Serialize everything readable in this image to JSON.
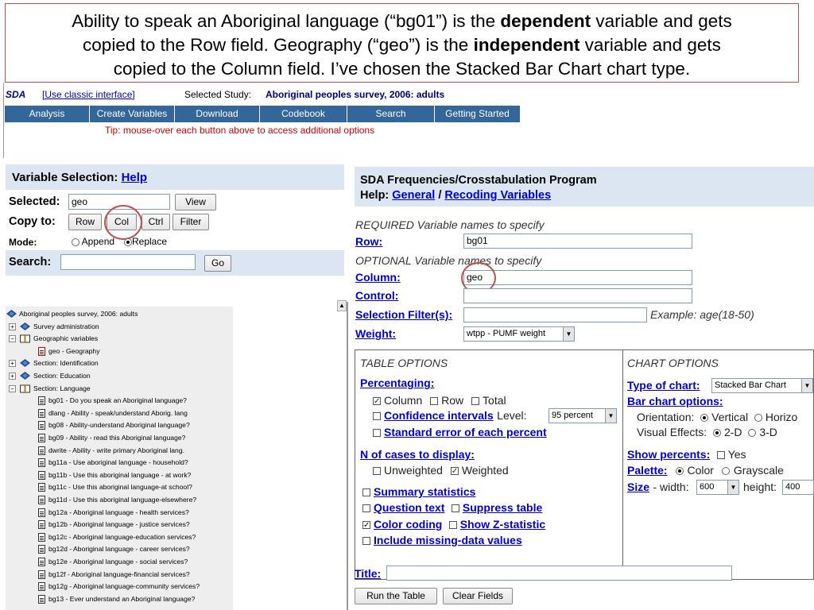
{
  "caption": {
    "line1_a": "Ability to speak an Aboriginal language (“bg01”) is the ",
    "line1_b": "dependent",
    "line1_c": " variable and gets",
    "line2_a": "copied to the Row field.  Geography (“geo”) is the ",
    "line2_b": "independent",
    "line2_c": " variable and gets",
    "line3": "copied to the Column field.  I’ve chosen the Stacked Bar Chart chart type."
  },
  "topbar": {
    "logo": "SDA",
    "classic_link": "[Use classic interface]",
    "study_label": "Selected Study:",
    "study_name": "Aboriginal peoples survey, 2006: adults"
  },
  "nav": [
    "Analysis",
    "Create Variables",
    "Download",
    "Codebook",
    "Search",
    "Getting Started"
  ],
  "tip": "Tip: mouse-over each button above to access additional options",
  "left": {
    "heading": "Variable Selection:",
    "help": "Help",
    "selected_label": "Selected:",
    "selected_value": "geo",
    "view": "View",
    "copy_label": "Copy to:",
    "row": "Row",
    "col": "Col",
    "ctrl": "Ctrl",
    "filter": "Filter",
    "mode_label": "Mode:",
    "append": "Append",
    "replace": "Replace",
    "search_label": "Search:",
    "go": "Go"
  },
  "tree": [
    {
      "text": "Aboriginal peoples survey, 2006: adults",
      "type": "root",
      "indent": 0
    },
    {
      "text": "Survey administration",
      "type": "book",
      "indent": 1
    },
    {
      "text": "Geographic variables",
      "type": "openbook",
      "indent": 1
    },
    {
      "text": "geo - Geography",
      "type": "doc-sel",
      "indent": 2
    },
    {
      "text": "Section: Identification",
      "type": "book",
      "indent": 1
    },
    {
      "text": "Section: Education",
      "type": "book",
      "indent": 1
    },
    {
      "text": "Section: Language",
      "type": "openbook",
      "indent": 1
    },
    {
      "text": "bg01 - Do you speak an Aboriginal language?",
      "type": "doc",
      "indent": 2
    },
    {
      "text": "dlang - Ability - speak/understand Aborig. lang",
      "type": "doc",
      "indent": 2
    },
    {
      "text": "bg08 - Ability-understand Aboriginal language?",
      "type": "doc",
      "indent": 2
    },
    {
      "text": "bg09 - Ability - read this Aboriginal language?",
      "type": "doc",
      "indent": 2
    },
    {
      "text": "dwrite - Ability - write primary Aboriginal lang.",
      "type": "doc",
      "indent": 2
    },
    {
      "text": "bg11a - Use aboriginal language - household?",
      "type": "doc",
      "indent": 2
    },
    {
      "text": "bg11b - Use this aboriginal language - at work?",
      "type": "doc",
      "indent": 2
    },
    {
      "text": "bg11c - Use this aboriginal language-at school?",
      "type": "doc",
      "indent": 2
    },
    {
      "text": "bg11d - Use this aboriginal language-elsewhere?",
      "type": "doc",
      "indent": 2
    },
    {
      "text": "bg12a - Aboriginal language - health services?",
      "type": "doc",
      "indent": 2
    },
    {
      "text": "bg12b - Aboriginal language - justice services?",
      "type": "doc",
      "indent": 2
    },
    {
      "text": "bg12c - Aboriginal language-education services?",
      "type": "doc",
      "indent": 2
    },
    {
      "text": "bg12d - Aboriginal language - career services?",
      "type": "doc",
      "indent": 2
    },
    {
      "text": "bg12e - Aboriginal language - social services?",
      "type": "doc",
      "indent": 2
    },
    {
      "text": "bg12f - Aboriginal language-financial services?",
      "type": "doc",
      "indent": 2
    },
    {
      "text": "bg12g - Aboriginal language-community services?",
      "type": "doc",
      "indent": 2
    },
    {
      "text": "bg13 - Ever understand an Aboriginal language?",
      "type": "doc",
      "indent": 2
    }
  ],
  "right": {
    "title": "SDA Frequencies/Crosstabulation Program",
    "help_label": "Help:",
    "help_general": "General",
    "help_sep": "/",
    "help_recoding": "Recoding Variables",
    "required": "REQUIRED Variable names to specify",
    "row_label": "Row:",
    "row_value": "bg01",
    "optional": "OPTIONAL Variable names to specify",
    "column_label": "Column:",
    "column_value": "geo",
    "control_label": "Control:",
    "control_value": "",
    "filter_label": "Selection Filter(s):",
    "filter_value": "",
    "filter_example": "Example: age(18-50)",
    "weight_label": "Weight:",
    "weight_value": "wtpp - PUMF weight",
    "title_label": "Title:",
    "title_value": "",
    "run": "Run the Table",
    "clear": "Clear Fields"
  },
  "table_options": {
    "heading": "TABLE OPTIONS",
    "percentaging": "Percentaging:",
    "column": "Column",
    "row": "Row",
    "total": "Total",
    "confidence": "Confidence intervals",
    "level_label": "Level:",
    "level_value": "95 percent",
    "std_error": "Standard error of each percent",
    "n_cases": "N of cases to display:",
    "unweighted": "Unweighted",
    "weighted": "Weighted",
    "summary": "Summary statistics",
    "question": "Question text",
    "suppress": "Suppress table",
    "color_coding": "Color coding",
    "z_stat": "Show Z-statistic",
    "missing": "Include missing-data values"
  },
  "chart_options": {
    "heading": "CHART OPTIONS",
    "type_label": "Type of chart:",
    "type_value": "Stacked Bar Chart",
    "bar_options": "Bar chart options:",
    "orientation_label": "Orientation:",
    "vertical": "Vertical",
    "horizontal": "Horizo",
    "effects_label": "Visual Effects:",
    "d2": "2-D",
    "d3": "3-D",
    "show_pct": "Show percents:",
    "yes": "Yes",
    "palette": "Palette:",
    "color": "Color",
    "grayscale": "Grayscale",
    "size": "Size",
    "width_label": "- width:",
    "width_value": "600",
    "height_label": "height:",
    "height_value": "400"
  },
  "colors": {
    "nav_bg": "#336699",
    "highlight_circle": "#c0504d",
    "link": "#0000cc",
    "panel_header": "#dce6f2"
  }
}
